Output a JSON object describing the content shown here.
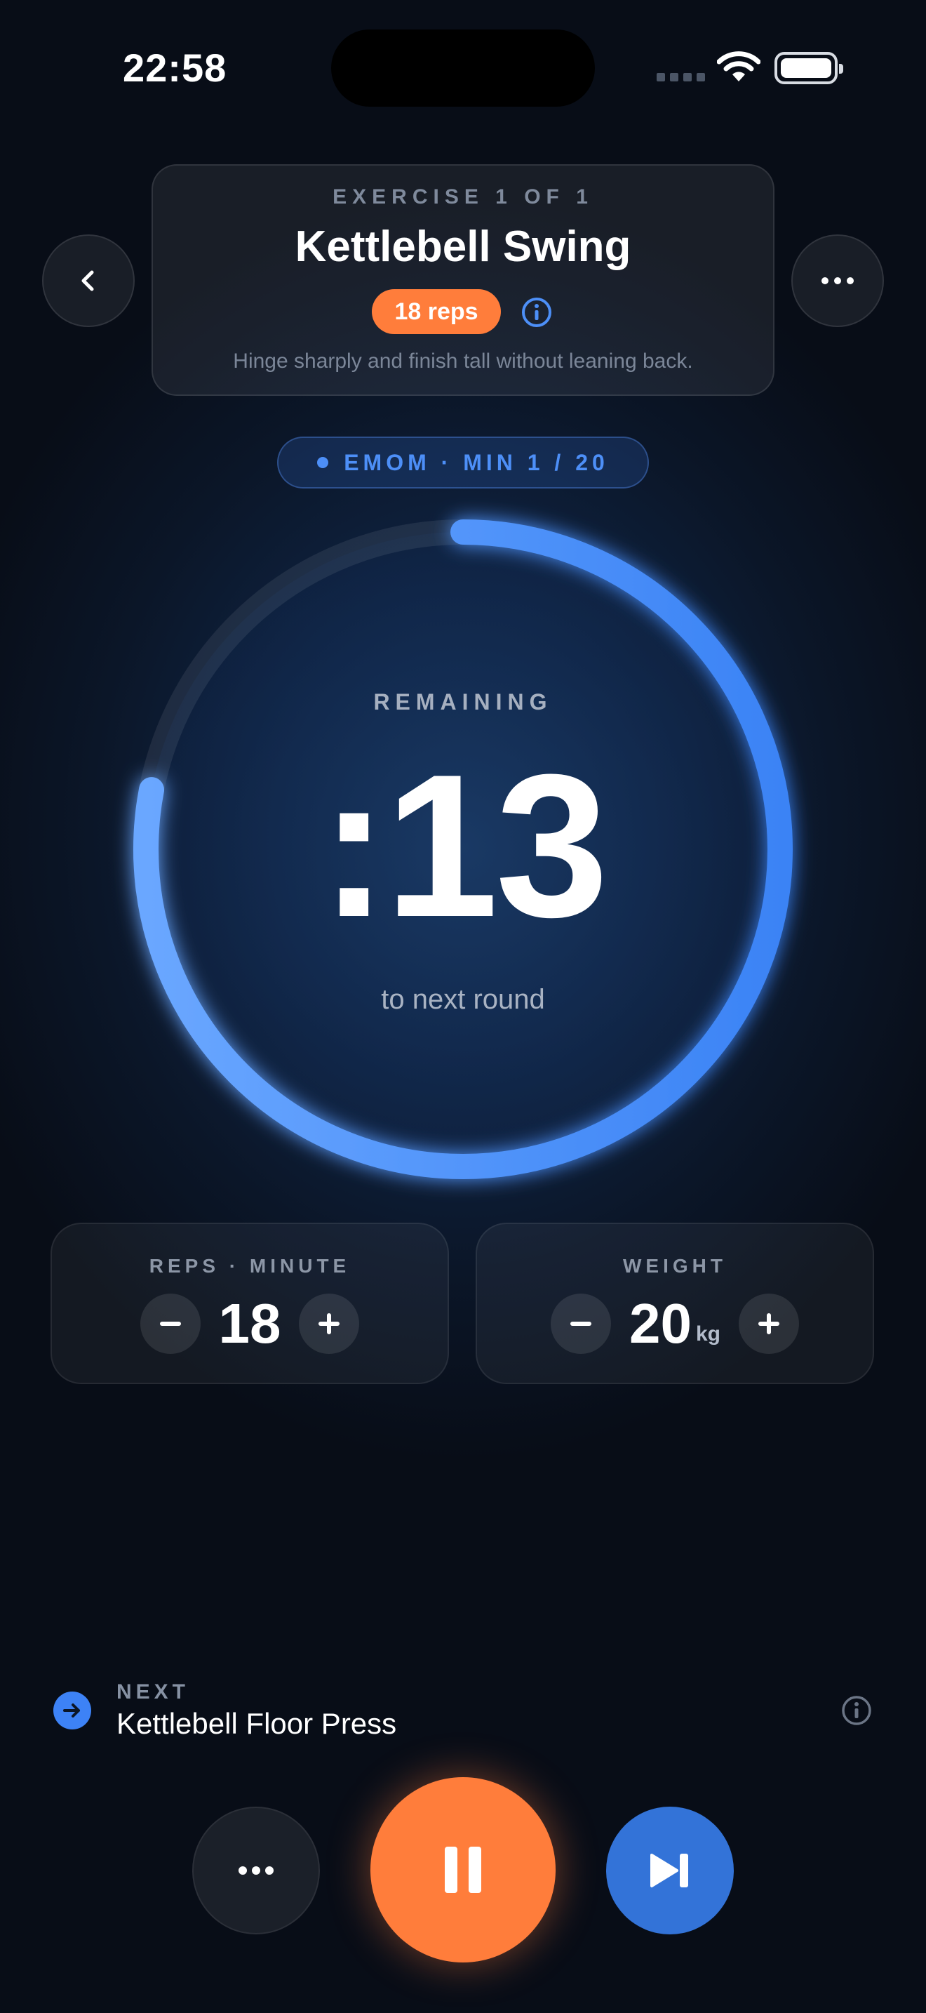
{
  "status_bar": {
    "time": "22:58"
  },
  "header": {
    "exercise_count": "EXERCISE 1 OF 1",
    "exercise_name": "Kettlebell Swing",
    "reps_badge": "18 reps",
    "cue": "Hinge sharply and finish tall without leaning back."
  },
  "emom": {
    "label": "EMOM · MIN 1 / 20"
  },
  "timer": {
    "label": "REMAINING",
    "value": ":13",
    "sub": "to next round",
    "progress_fraction": 0.78
  },
  "steppers": {
    "reps": {
      "label": "REPS · MINUTE",
      "value": "18"
    },
    "weight": {
      "label": "WEIGHT",
      "value": "20",
      "unit": "kg"
    }
  },
  "next": {
    "label": "NEXT",
    "name": "Kettlebell Floor Press"
  },
  "colors": {
    "accent_orange": "#ff7d3b",
    "accent_blue": "#3d82f6",
    "ring_blue": "#5a9bff"
  },
  "icons": {
    "back": "chevron-left-icon",
    "menu": "ellipsis-icon",
    "info": "info-icon",
    "next": "arrow-right-icon",
    "pause": "pause-icon",
    "skip": "skip-forward-icon"
  }
}
